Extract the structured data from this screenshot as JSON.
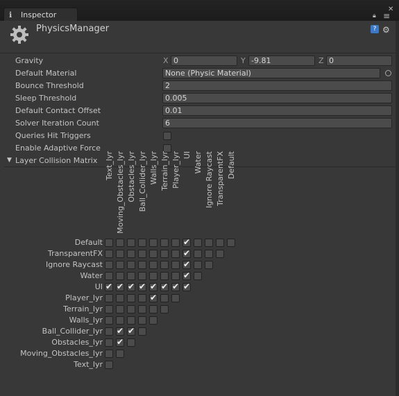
{
  "window": {
    "tab_title": "Inspector",
    "lock_icon": "lock-icon",
    "menu_icon": "window-menu-icon",
    "close_icon": "close-icon"
  },
  "header": {
    "object_name": "PhysicsManager",
    "help_icon": "help-icon",
    "settings_icon": "gear-icon"
  },
  "properties": {
    "gravity": {
      "label": "Gravity",
      "x_label": "X",
      "x": "0",
      "y_label": "Y",
      "y": "-9.81",
      "z_label": "Z",
      "z": "0"
    },
    "default_material": {
      "label": "Default Material",
      "value": "None (Physic Material)"
    },
    "bounce_threshold": {
      "label": "Bounce Threshold",
      "value": "2"
    },
    "sleep_threshold": {
      "label": "Sleep Threshold",
      "value": "0.005"
    },
    "default_contact_offset": {
      "label": "Default Contact Offset",
      "value": "0.01"
    },
    "solver_iteration_count": {
      "label": "Solver Iteration Count",
      "value": "6"
    },
    "queries_hit_triggers": {
      "label": "Queries Hit Triggers",
      "checked": false
    },
    "enable_adaptive_force": {
      "label": "Enable Adaptive Force",
      "checked": false
    },
    "layer_collision_matrix": {
      "label": "Layer Collision Matrix",
      "expanded": true
    }
  },
  "matrix": {
    "column_labels": [
      "Text_lyr",
      "Moving_Obstacles_lyr",
      "Obstacles_lyr",
      "Ball_Collider_lyr",
      "Walls_lyr",
      "Terrain_lyr",
      "Player_lyr",
      "UI",
      "Water",
      "Ignore Raycast",
      "TransparentFX",
      "Default"
    ],
    "rows": [
      {
        "name": "Default",
        "cells": [
          false,
          false,
          false,
          false,
          false,
          false,
          false,
          true,
          false,
          false,
          false,
          false
        ]
      },
      {
        "name": "TransparentFX",
        "cells": [
          false,
          false,
          false,
          false,
          false,
          false,
          false,
          true,
          false,
          false,
          false
        ]
      },
      {
        "name": "Ignore Raycast",
        "cells": [
          false,
          false,
          false,
          false,
          false,
          false,
          false,
          true,
          false,
          false
        ]
      },
      {
        "name": "Water",
        "cells": [
          false,
          false,
          false,
          false,
          false,
          false,
          false,
          true,
          false
        ]
      },
      {
        "name": "UI",
        "cells": [
          true,
          true,
          true,
          true,
          true,
          true,
          true,
          true
        ]
      },
      {
        "name": "Player_lyr",
        "cells": [
          false,
          false,
          false,
          false,
          true,
          false,
          false
        ]
      },
      {
        "name": "Terrain_lyr",
        "cells": [
          false,
          false,
          false,
          false,
          false,
          false
        ]
      },
      {
        "name": "Walls_lyr",
        "cells": [
          false,
          false,
          false,
          false,
          false
        ]
      },
      {
        "name": "Ball_Collider_lyr",
        "cells": [
          false,
          true,
          true,
          false
        ]
      },
      {
        "name": "Obstacles_lyr",
        "cells": [
          false,
          true,
          false
        ]
      },
      {
        "name": "Moving_Obstacles_lyr",
        "cells": [
          false,
          false
        ]
      },
      {
        "name": "Text_lyr",
        "cells": [
          false
        ]
      }
    ]
  }
}
